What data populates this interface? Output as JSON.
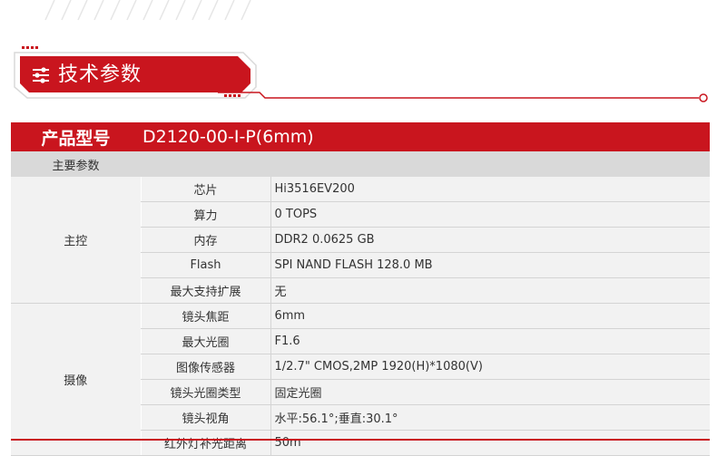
{
  "banner": {
    "title": "技术参数",
    "icon": "sliders-icon",
    "accent_color": "#c9151e"
  },
  "table": {
    "model_label": "产品型号",
    "model_value": "D2120-00-I-P(6mm)",
    "section_label": "主要参数",
    "groups": [
      {
        "name": "主控",
        "rows": [
          {
            "param": "芯片",
            "value": "Hi3516EV200"
          },
          {
            "param": "算力",
            "value": "0 TOPS"
          },
          {
            "param": "内存",
            "value": "DDR2 0.0625 GB"
          },
          {
            "param": "Flash",
            "value": "SPI NAND FLASH 128.0 MB"
          },
          {
            "param": "最大支持扩展",
            "value": "无"
          }
        ]
      },
      {
        "name": "摄像",
        "rows": [
          {
            "param": "镜头焦距",
            "value": "6mm"
          },
          {
            "param": "最大光圈",
            "value": "F1.6"
          },
          {
            "param": "图像传感器",
            "value": "1/2.7\" CMOS,2MP 1920(H)*1080(V)"
          },
          {
            "param": "镜头光圈类型",
            "value": "固定光圈"
          },
          {
            "param": "镜头视角",
            "value": "水平:56.1°;垂直:30.1°"
          },
          {
            "param": "红外灯补光距离",
            "value": "50m"
          }
        ]
      }
    ]
  }
}
